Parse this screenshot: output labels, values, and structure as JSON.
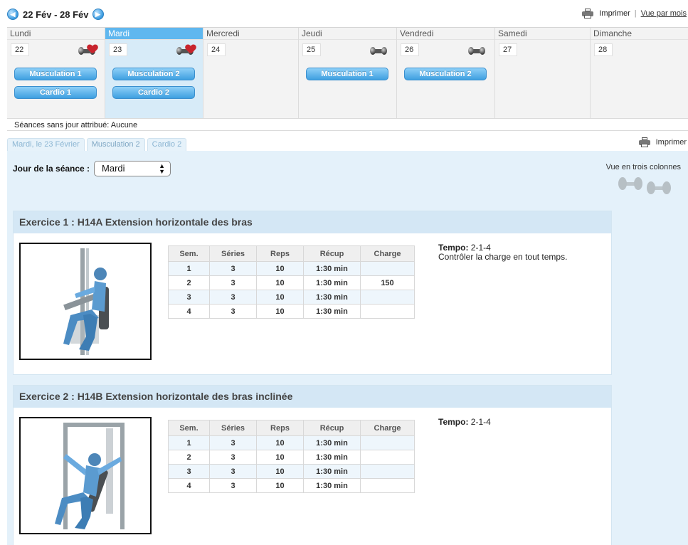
{
  "week": {
    "label": "22 Fév - 28 Fév",
    "prev_icon": "chevron-left-icon",
    "next_icon": "chevron-right-icon"
  },
  "top_actions": {
    "print_label": "Imprimer",
    "separator": "|",
    "month_view_label": "Vue par mois"
  },
  "calendar": {
    "days": [
      {
        "name": "Lundi",
        "num": "22",
        "icon": "heart-dumbbell-icon",
        "sessions": [
          "Musculation 1",
          "Cardio 1"
        ],
        "active": false
      },
      {
        "name": "Mardi",
        "num": "23",
        "icon": "heart-dumbbell-icon",
        "sessions": [
          "Musculation 2",
          "Cardio 2"
        ],
        "active": true
      },
      {
        "name": "Mercredi",
        "num": "24",
        "icon": "",
        "sessions": [],
        "active": false
      },
      {
        "name": "Jeudi",
        "num": "25",
        "icon": "dumbbell-icon",
        "sessions": [
          "Musculation 1"
        ],
        "active": false
      },
      {
        "name": "Vendredi",
        "num": "26",
        "icon": "dumbbell-icon",
        "sessions": [
          "Musculation 2"
        ],
        "active": false
      },
      {
        "name": "Samedi",
        "num": "27",
        "icon": "",
        "sessions": [],
        "active": false
      },
      {
        "name": "Dimanche",
        "num": "28",
        "icon": "",
        "sessions": [],
        "active": false
      }
    ],
    "footer": "Séances sans jour attribué: Aucune"
  },
  "tabs": [
    {
      "label": "Mardi, le 23 Février"
    },
    {
      "label": "Musculation 2"
    },
    {
      "label": "Cardio 2"
    }
  ],
  "print2_label": "Imprimer",
  "session": {
    "day_label": "Jour de la séance :",
    "day_value": "Mardi",
    "three_col_label": "Vue en trois colonnes"
  },
  "exercises": [
    {
      "title": "Exercice 1 : H14A Extension horizontale des bras",
      "headers": [
        "Sem.",
        "Séries",
        "Reps",
        "Récup",
        "Charge"
      ],
      "rows": [
        [
          "1",
          "3",
          "10",
          "1:30 min",
          ""
        ],
        [
          "2",
          "3",
          "10",
          "1:30 min",
          "150"
        ],
        [
          "3",
          "3",
          "10",
          "1:30 min",
          ""
        ],
        [
          "4",
          "3",
          "10",
          "1:30 min",
          ""
        ]
      ],
      "tempo_label": "Tempo:",
      "tempo_value": "2-1-4",
      "note": "Contrôler la charge en tout temps."
    },
    {
      "title": "Exercice 2 : H14B Extension horizontale des bras inclinée",
      "headers": [
        "Sem.",
        "Séries",
        "Reps",
        "Récup",
        "Charge"
      ],
      "rows": [
        [
          "1",
          "3",
          "10",
          "1:30 min",
          ""
        ],
        [
          "2",
          "3",
          "10",
          "1:30 min",
          ""
        ],
        [
          "3",
          "3",
          "10",
          "1:30 min",
          ""
        ],
        [
          "4",
          "3",
          "10",
          "1:30 min",
          ""
        ]
      ],
      "tempo_label": "Tempo:",
      "tempo_value": "2-1-4",
      "note": ""
    }
  ],
  "colors": {
    "accent": "#5fb7ef",
    "pill": "#3f9fe0",
    "panel": "#e4f1fa",
    "exercise_head": "#d4e7f5",
    "heart": "#c8242d"
  }
}
